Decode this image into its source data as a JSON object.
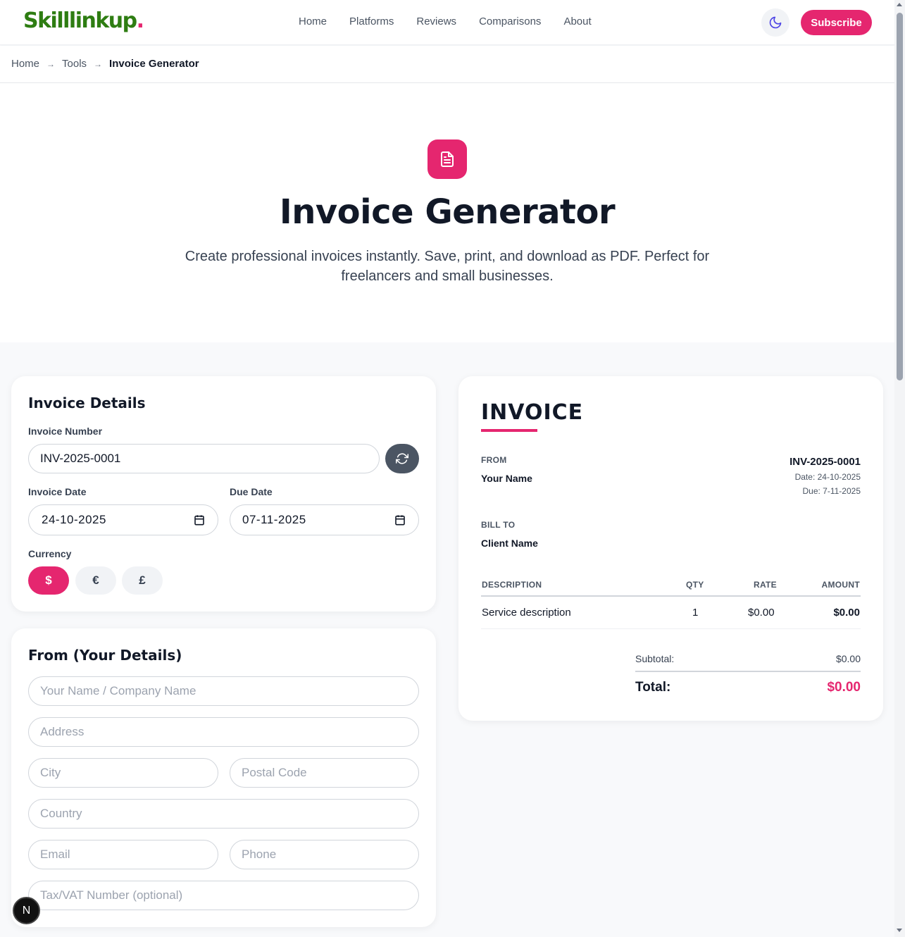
{
  "header": {
    "logo_text": "Skilllinkup",
    "logo_dot": ".",
    "nav": [
      "Home",
      "Platforms",
      "Reviews",
      "Comparisons",
      "About"
    ],
    "theme_icon": "moon-icon",
    "subscribe_label": "Subscribe"
  },
  "breadcrumb": {
    "items": [
      "Home",
      "Tools",
      "Invoice Generator"
    ],
    "separator": "→"
  },
  "hero": {
    "icon": "document-icon",
    "title": "Invoice Generator",
    "subtitle": "Create professional invoices instantly. Save, print, and download as PDF. Perfect for freelancers and small businesses."
  },
  "invoice_details": {
    "title": "Invoice Details",
    "number_label": "Invoice Number",
    "number_value": "INV-2025-0001",
    "refresh_icon": "refresh-icon",
    "date_label": "Invoice Date",
    "date_value": "24-10-2025",
    "due_label": "Due Date",
    "due_value": "07-11-2025",
    "currency_label": "Currency",
    "currencies": [
      "$",
      "€",
      "£"
    ],
    "selected_currency": "$"
  },
  "from_details": {
    "title": "From (Your Details)",
    "placeholders": {
      "name": "Your Name / Company Name",
      "address": "Address",
      "city": "City",
      "postal": "Postal Code",
      "country": "Country",
      "email": "Email",
      "phone": "Phone",
      "tax": "Tax/VAT Number (optional)"
    }
  },
  "preview": {
    "heading": "INVOICE",
    "from_label": "FROM",
    "from_name": "Your Name",
    "number": "INV-2025-0001",
    "date_line": "Date: 24-10-2025",
    "due_line": "Due: 7-11-2025",
    "bill_to_label": "BILL TO",
    "client_name": "Client Name",
    "columns": [
      "DESCRIPTION",
      "QTY",
      "RATE",
      "AMOUNT"
    ],
    "rows": [
      {
        "description": "Service description",
        "qty": "1",
        "rate": "$0.00",
        "amount": "$0.00"
      }
    ],
    "subtotal_label": "Subtotal:",
    "subtotal_value": "$0.00",
    "total_label": "Total:",
    "total_value": "$0.00"
  },
  "floating_badge": "N",
  "colors": {
    "accent": "#e5266f",
    "logo_green": "#2e7d12",
    "dark_button": "#4b5563"
  }
}
